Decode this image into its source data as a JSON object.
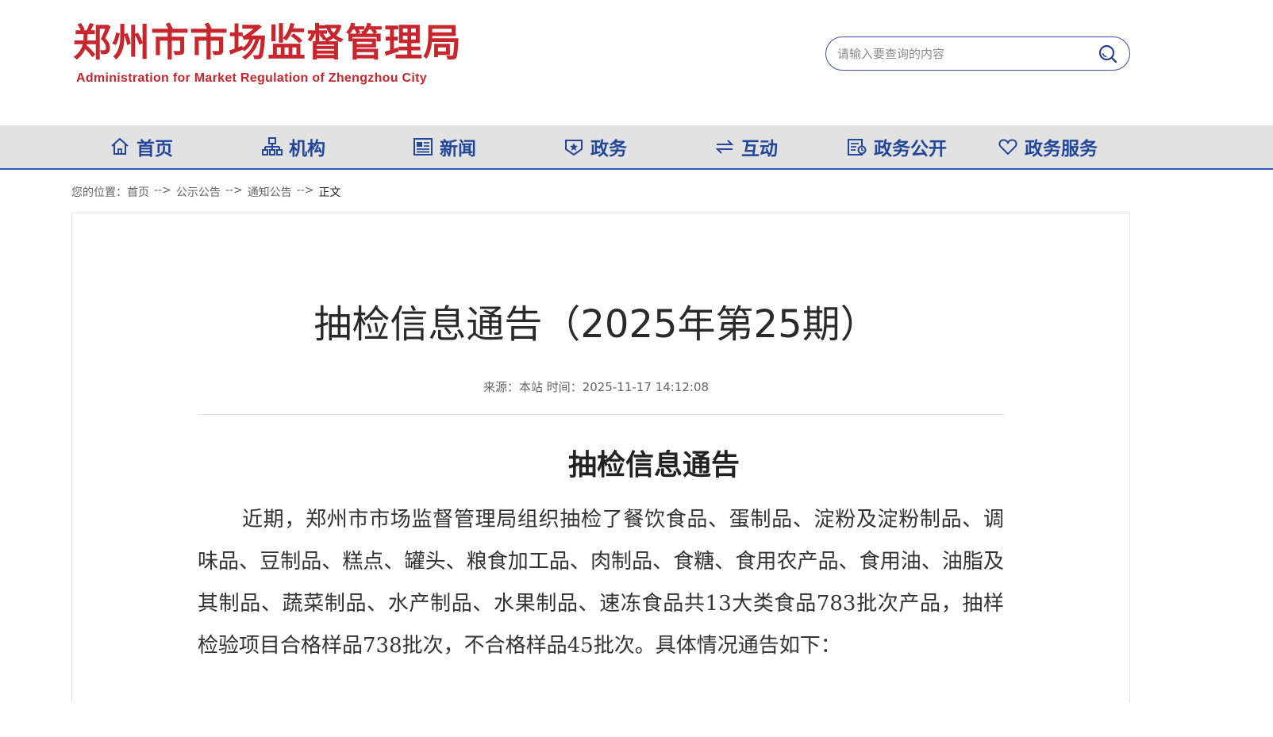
{
  "header": {
    "logo_title": "郑州市市场监督管理局",
    "logo_subtitle": "Administration for Market Regulation of Zhengzhou City",
    "brand_color": "#c8262c",
    "search": {
      "placeholder": "请输入要查询的内容",
      "icon": "search-icon"
    }
  },
  "nav": {
    "accent_color": "#22479a",
    "items": [
      {
        "label": "首页",
        "icon": "home-icon"
      },
      {
        "label": "机构",
        "icon": "org-chart-icon"
      },
      {
        "label": "新闻",
        "icon": "newspaper-icon"
      },
      {
        "label": "政务",
        "icon": "government-shield-icon"
      },
      {
        "label": "互动",
        "icon": "exchange-arrows-icon"
      },
      {
        "label": "政务公开",
        "icon": "document-disclosure-icon"
      },
      {
        "label": "政务服务",
        "icon": "heart-icon"
      }
    ]
  },
  "breadcrumb": {
    "prefix": "您的位置：",
    "items": [
      "首页",
      "公示公告",
      "通知公告"
    ],
    "separator": "-->",
    "current": "正文"
  },
  "article": {
    "title": "抽检信息通告（2025年第25期）",
    "meta": "来源：本站  时间：2025-11-17 14:12:08",
    "subtitle": "抽检信息通告",
    "body": "近期，郑州市市场监督管理局组织抽检了餐饮食品、蛋制品、淀粉及淀粉制品、调味品、豆制品、糕点、罐头、粮食加工品、肉制品、食糖、食用农产品、食用油、油脂及其制品、蔬菜制品、水产制品、水果制品、速冻食品共13大类食品783批次产品，抽样检验项目合格样品738批次，不合格样品45批次。具体情况通告如下："
  }
}
